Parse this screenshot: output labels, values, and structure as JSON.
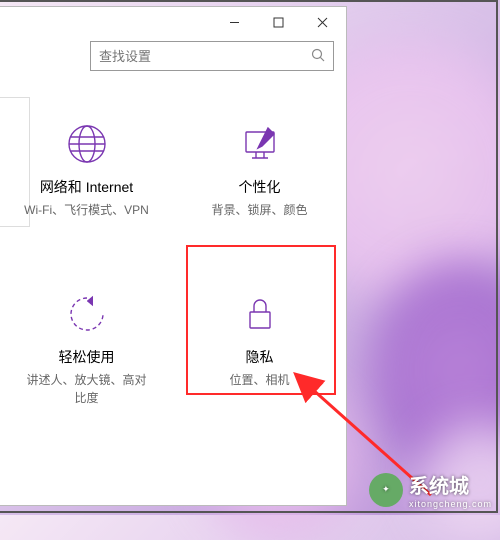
{
  "search": {
    "placeholder": "查找设置"
  },
  "tiles": [
    {
      "title": "网络和 Internet",
      "sub": "Wi-Fi、飞行模式、VPN"
    },
    {
      "title": "个性化",
      "sub": "背景、锁屏、颜色"
    },
    {
      "title": "轻松使用",
      "sub": "讲述人、放大镜、高对比度"
    },
    {
      "title": "隐私",
      "sub": "位置、相机"
    }
  ],
  "watermark": {
    "brand": "系统城",
    "url": "xitongcheng.com"
  },
  "colors": {
    "accent": "#7a36b1",
    "highlight": "#ff2a2a"
  }
}
